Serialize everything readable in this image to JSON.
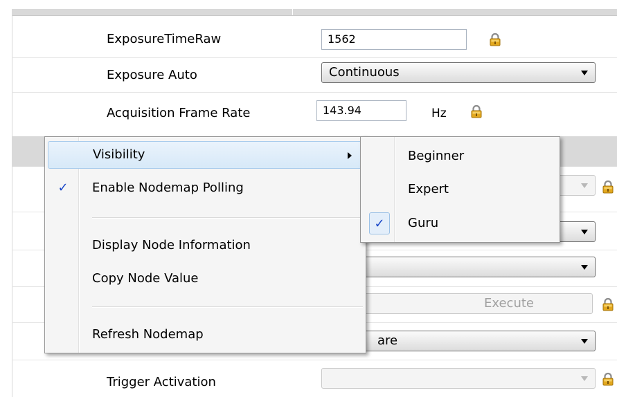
{
  "properties": {
    "exposure_time_raw": {
      "label": "ExposureTimeRaw",
      "value": "1562"
    },
    "exposure_auto": {
      "label": "Exposure Auto",
      "value": "Continuous"
    },
    "acquisition_frame_rate": {
      "label": "Acquisition Frame Rate",
      "value": "143.94",
      "unit": "Hz"
    },
    "execute_button": {
      "label": "Execute"
    },
    "trigger_source_partial": {
      "value": "are"
    },
    "trigger_activation": {
      "label": "Trigger Activation",
      "value": ""
    }
  },
  "context_menu": {
    "items": [
      {
        "label": "Visibility",
        "has_submenu": true,
        "highlighted": true
      },
      {
        "label": "Enable Nodemap Polling",
        "checked": true
      },
      {
        "label": "Display Node Information"
      },
      {
        "label": "Copy Node Value"
      },
      {
        "label": "Refresh Nodemap"
      }
    ]
  },
  "visibility_submenu": {
    "items": [
      {
        "label": "Beginner",
        "checked": false
      },
      {
        "label": "Expert",
        "checked": false
      },
      {
        "label": "Guru",
        "checked": true
      }
    ]
  },
  "icons": {
    "lock": "lock-icon",
    "check": "checkmark-icon",
    "dropdown": "chevron-down-icon",
    "submenu": "chevron-right-icon"
  },
  "colors": {
    "menu_highlight": "#d7e9f8",
    "check_mark": "#1a47c8",
    "lock_body": "#e3a81e"
  }
}
